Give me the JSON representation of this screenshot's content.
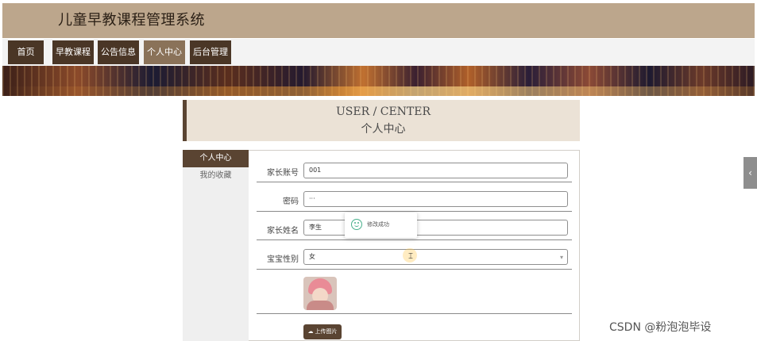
{
  "header": {
    "title": "儿童早教课程管理系统"
  },
  "nav": {
    "items": [
      {
        "label": "首页"
      },
      {
        "label": "早教课程"
      },
      {
        "label": "公告信息"
      },
      {
        "label": "个人中心"
      },
      {
        "label": "后台管理"
      }
    ],
    "active_index": 3
  },
  "center": {
    "title_en": "USER / CENTER",
    "title_cn": "个人中心"
  },
  "sidebar": {
    "items": [
      {
        "label": "个人中心"
      },
      {
        "label": "我的收藏"
      }
    ]
  },
  "form": {
    "account": {
      "label": "家长账号",
      "value": "001"
    },
    "password": {
      "label": "密码",
      "value": "···"
    },
    "name": {
      "label": "家长姓名",
      "value": "李生"
    },
    "gender": {
      "label": "宝宝性别",
      "value": "女"
    }
  },
  "toast": {
    "text": "修改成功"
  },
  "upload": {
    "label": "上传图片"
  },
  "watermark": "CSDN @粉泡泡毕设",
  "icons": {
    "success": "smile-icon",
    "upload": "cloud-icon",
    "dropdown": "chevron-down-icon",
    "toggle": "chevron-left-icon"
  },
  "colors": {
    "header_bg": "#bca68c",
    "nav_item_bg": "#4a3626",
    "nav_active_bg": "#8a7259",
    "accent": "#5a4432",
    "toast_icon": "#48b08c"
  }
}
